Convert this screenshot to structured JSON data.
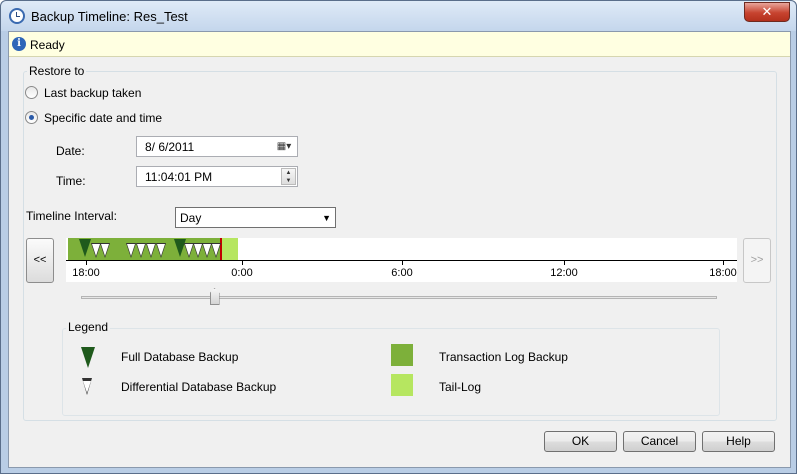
{
  "window": {
    "title": "Backup Timeline: Res_Test",
    "close_label": "✕"
  },
  "status": {
    "text": "Ready",
    "icon": "info-icon"
  },
  "restore": {
    "group_label": "Restore to",
    "options": [
      {
        "label": "Last backup taken",
        "selected": false
      },
      {
        "label": "Specific date and time",
        "selected": true
      }
    ],
    "date_label": "Date:",
    "date_value": "8/  6/2011",
    "time_label": "Time:",
    "time_value": "11:04:01 PM"
  },
  "timeline": {
    "interval_label": "Timeline Interval:",
    "interval_value": "Day",
    "prev_label": "<<",
    "next_label": ">>",
    "ticks": [
      "18:00",
      "0:00",
      "6:00",
      "12:00",
      "18:00"
    ],
    "slider_fraction": 0.21
  },
  "legend": {
    "title": "Legend",
    "items": [
      {
        "label": "Full Database Backup",
        "icon": "full-backup-icon"
      },
      {
        "label": "Differential Database Backup",
        "icon": "differential-backup-icon"
      },
      {
        "label": "Transaction Log Backup",
        "color": "#7db03a"
      },
      {
        "label": "Tail-Log",
        "color": "#b6e660"
      }
    ]
  },
  "buttons": {
    "ok": "OK",
    "cancel": "Cancel",
    "help": "Help"
  }
}
